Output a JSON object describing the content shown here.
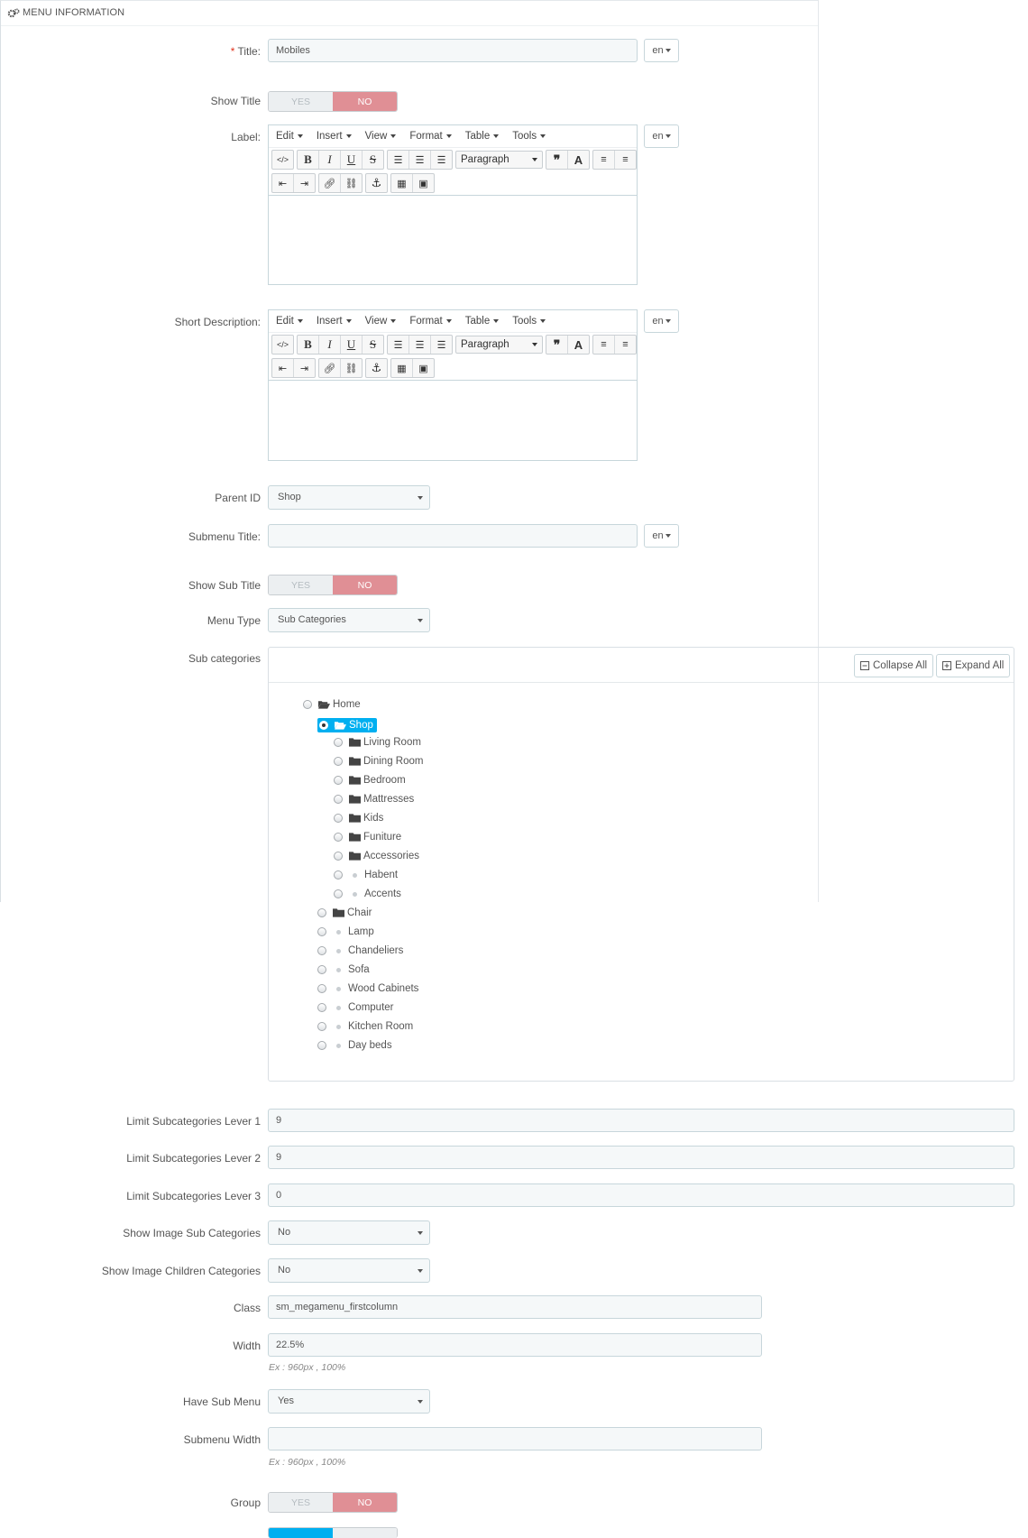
{
  "panel": {
    "title": "MENU INFORMATION",
    "icon": "cogs-icon"
  },
  "title_field": {
    "label": "Title:",
    "required_mark": "*",
    "value": "Mobiles",
    "lang": "en"
  },
  "show_title": {
    "label": "Show Title",
    "yes": "YES",
    "no": "NO",
    "selected": "NO"
  },
  "label_field": {
    "label": "Label:",
    "lang": "en"
  },
  "short_desc": {
    "label": "Short Description:",
    "lang": "en"
  },
  "editor": {
    "menus": [
      "Edit",
      "Insert",
      "View",
      "Format",
      "Table",
      "Tools"
    ],
    "block_format": "Paragraph"
  },
  "parent_id": {
    "label": "Parent ID",
    "value": "Shop"
  },
  "submenu_title": {
    "label": "Submenu Title:",
    "value": "",
    "lang": "en"
  },
  "show_sub_title": {
    "label": "Show Sub Title",
    "yes": "YES",
    "no": "NO",
    "selected": "NO"
  },
  "menu_type": {
    "label": "Menu Type",
    "value": "Sub Categories"
  },
  "sub_categories": {
    "label": "Sub categories",
    "collapse_all": "Collapse All",
    "expand_all": "Expand All",
    "tree": [
      {
        "name": "Home",
        "type": "open-folder",
        "level": 0
      },
      {
        "name": "Shop",
        "type": "open-folder",
        "level": 1,
        "selected": true
      },
      {
        "name": "Living Room",
        "type": "folder",
        "level": 2
      },
      {
        "name": "Dining Room",
        "type": "folder",
        "level": 2
      },
      {
        "name": "Bedroom",
        "type": "folder",
        "level": 2
      },
      {
        "name": "Mattresses",
        "type": "folder",
        "level": 2
      },
      {
        "name": "Kids",
        "type": "folder",
        "level": 2
      },
      {
        "name": "Funiture",
        "type": "folder",
        "level": 2
      },
      {
        "name": "Accessories",
        "type": "folder",
        "level": 2
      },
      {
        "name": "Habent",
        "type": "leaf",
        "level": 2
      },
      {
        "name": "Accents",
        "type": "leaf",
        "level": 2
      },
      {
        "name": "Chair",
        "type": "folder",
        "level": 1
      },
      {
        "name": "Lamp",
        "type": "leaf",
        "level": 1
      },
      {
        "name": "Chandeliers",
        "type": "leaf",
        "level": 1
      },
      {
        "name": "Sofa",
        "type": "leaf",
        "level": 1
      },
      {
        "name": "Wood Cabinets",
        "type": "leaf",
        "level": 1
      },
      {
        "name": "Computer",
        "type": "leaf",
        "level": 1
      },
      {
        "name": "Kitchen Room",
        "type": "leaf",
        "level": 1
      },
      {
        "name": "Day beds",
        "type": "leaf",
        "level": 1
      }
    ]
  },
  "limit1": {
    "label": "Limit Subcategories Lever 1",
    "value": "9"
  },
  "limit2": {
    "label": "Limit Subcategories Lever 2",
    "value": "9"
  },
  "limit3": {
    "label": "Limit Subcategories Lever 3",
    "value": "0"
  },
  "show_image_sub": {
    "label": "Show Image Sub Categories",
    "value": "No"
  },
  "show_image_children": {
    "label": "Show Image Children Categories",
    "value": "No"
  },
  "class_field": {
    "label": "Class",
    "value": "sm_megamenu_firstcolumn"
  },
  "width_field": {
    "label": "Width",
    "value": "22.5%",
    "hint": "Ex : 960px , 100%"
  },
  "have_sub_menu": {
    "label": "Have Sub Menu",
    "value": "Yes"
  },
  "submenu_width": {
    "label": "Submenu Width",
    "value": "",
    "hint": "Ex : 960px , 100%"
  },
  "group": {
    "label": "Group",
    "yes": "YES",
    "no": "NO",
    "selected": "NO"
  },
  "colors": {
    "accent": "#00aff0",
    "switch_on": "#e08f95",
    "input_bg": "#f5f8f9",
    "border": "#c7d6db"
  }
}
